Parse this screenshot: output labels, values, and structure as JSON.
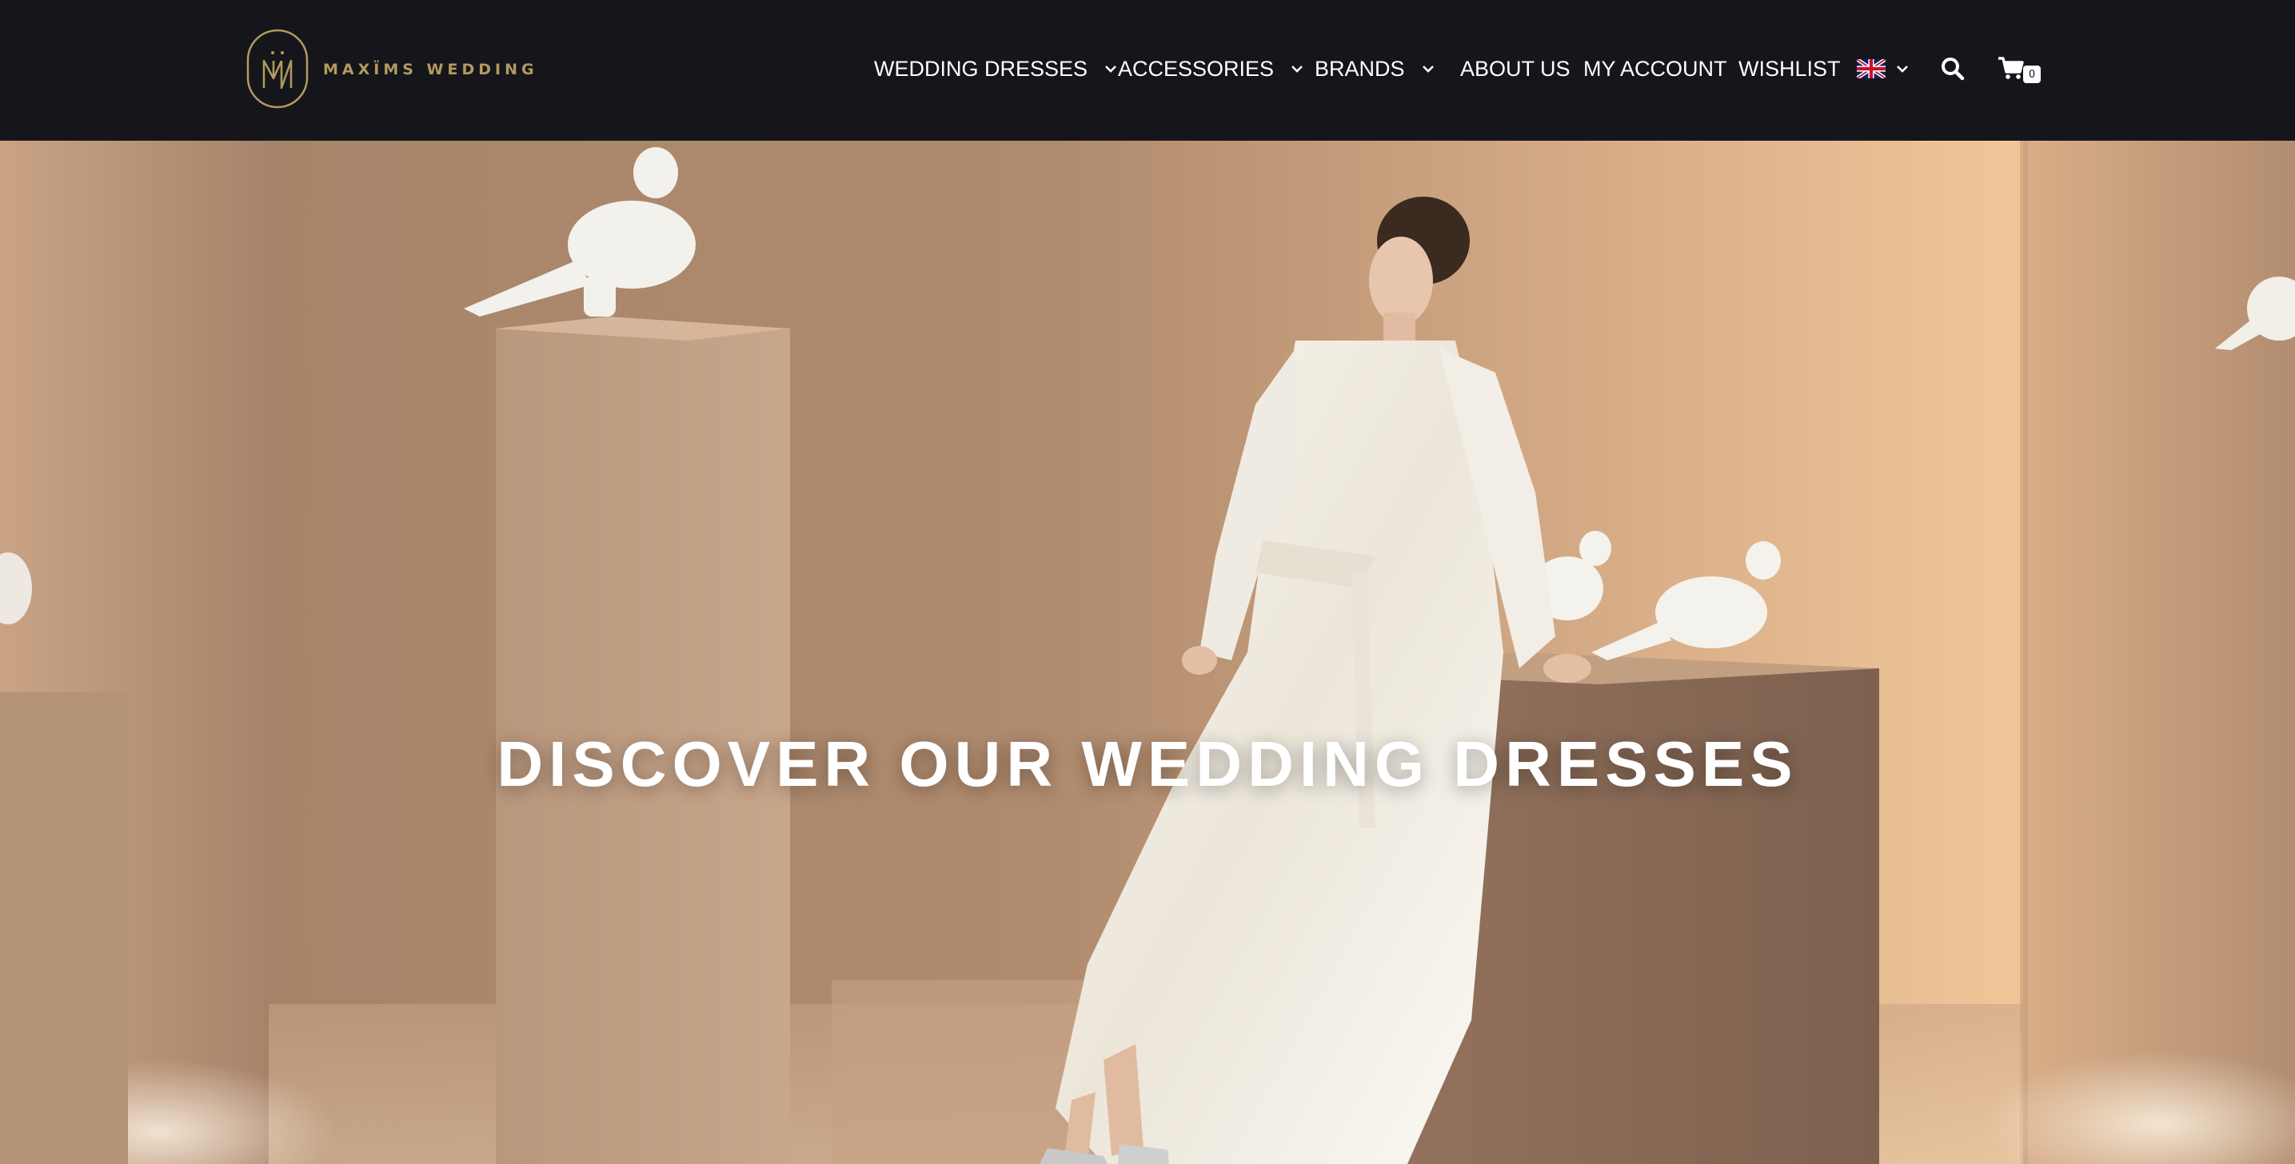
{
  "brand": {
    "name": "MAXÏMS WEDDING",
    "logo_monogram": "MW",
    "logo_color": "#b39a5e"
  },
  "nav": {
    "items": [
      {
        "label": "WEDDING DRESSES",
        "has_dropdown": true
      },
      {
        "label": "ACCESSORIES",
        "has_dropdown": true
      },
      {
        "label": "BRANDS",
        "has_dropdown": true
      },
      {
        "label": "ABOUT US",
        "has_dropdown": false
      },
      {
        "label": "MY ACCOUNT",
        "has_dropdown": false
      },
      {
        "label": "WISHLIST",
        "has_dropdown": false
      }
    ],
    "language": {
      "icon": "uk-flag-icon",
      "has_dropdown": true
    },
    "search_icon": "search-icon",
    "cart": {
      "icon": "cart-icon",
      "count": "0"
    }
  },
  "hero": {
    "title": "DISCOVER OUR WEDDING DRESSES"
  },
  "colors": {
    "header_bg": "#15161c",
    "nav_text": "#ffffff",
    "hero_warm": "#c79f7d"
  }
}
